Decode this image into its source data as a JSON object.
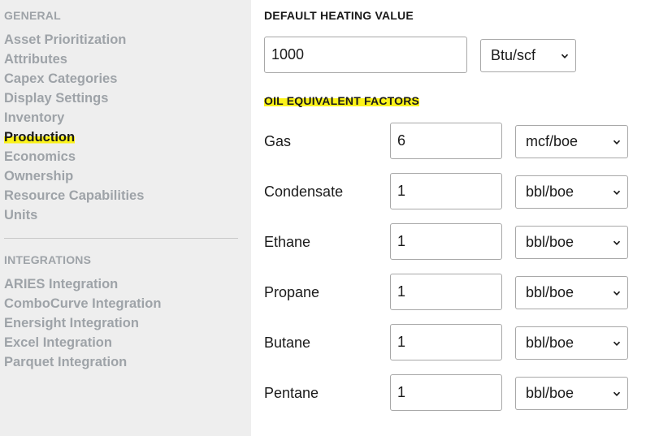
{
  "sidebar": {
    "general_title": "GENERAL",
    "general_items": [
      {
        "label": "Asset Prioritization"
      },
      {
        "label": "Attributes"
      },
      {
        "label": "Capex Categories"
      },
      {
        "label": "Display Settings"
      },
      {
        "label": "Inventory"
      },
      {
        "label": "Production",
        "active": true
      },
      {
        "label": "Economics"
      },
      {
        "label": "Ownership"
      },
      {
        "label": "Resource Capabilities"
      },
      {
        "label": "Units"
      }
    ],
    "integrations_title": "INTEGRATIONS",
    "integration_items": [
      {
        "label": "ARIES Integration"
      },
      {
        "label": "ComboCurve Integration"
      },
      {
        "label": "Enersight Integration"
      },
      {
        "label": "Excel Integration"
      },
      {
        "label": "Parquet Integration"
      }
    ]
  },
  "main": {
    "heating": {
      "title": "DEFAULT HEATING VALUE",
      "value": "1000",
      "unit": "Btu/scf"
    },
    "oil_equivalent": {
      "title": "OIL EQUIVALENT FACTORS",
      "rows": [
        {
          "label": "Gas",
          "value": "6",
          "unit": "mcf/boe"
        },
        {
          "label": "Condensate",
          "value": "1",
          "unit": "bbl/boe"
        },
        {
          "label": "Ethane",
          "value": "1",
          "unit": "bbl/boe"
        },
        {
          "label": "Propane",
          "value": "1",
          "unit": "bbl/boe"
        },
        {
          "label": "Butane",
          "value": "1",
          "unit": "bbl/boe"
        },
        {
          "label": "Pentane",
          "value": "1",
          "unit": "bbl/boe"
        }
      ]
    }
  },
  "colors": {
    "highlight": "#fbf21a",
    "sidebar_bg": "#eeeeee",
    "muted_text": "#9ea3a8"
  },
  "icons": {
    "select_arrow": "chevron-down-icon"
  }
}
